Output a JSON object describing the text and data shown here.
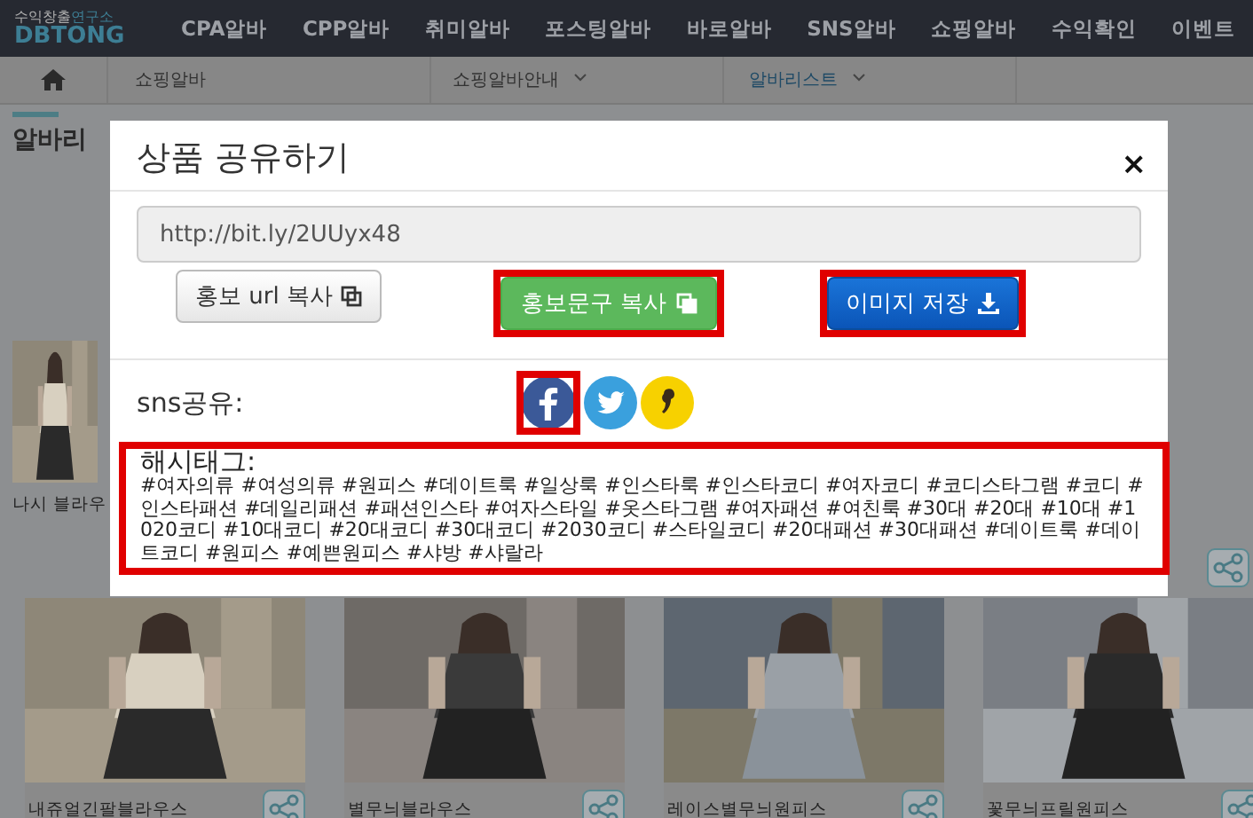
{
  "header": {
    "logo_top": "수익창출",
    "logo_top_accent": "연구소",
    "logo": "DBTONG",
    "nav": [
      {
        "label": "CPA알바",
        "selected": false
      },
      {
        "label": "CPP알바",
        "selected": false
      },
      {
        "label": "취미알바",
        "selected": false
      },
      {
        "label": "포스팅알바",
        "selected": false
      },
      {
        "label": "바로알바",
        "selected": false
      },
      {
        "label": "SNS알바",
        "selected": false
      },
      {
        "label": "쇼핑알바",
        "selected": false
      },
      {
        "label": "수익확인",
        "selected": false
      },
      {
        "label": "이벤트",
        "selected": false
      }
    ]
  },
  "subnav": [
    {
      "label": "쇼핑알바",
      "kind": "plain",
      "selected": false
    },
    {
      "label": "쇼핑알바안내",
      "kind": "dropdown",
      "selected": false
    },
    {
      "label": "알바리스트",
      "kind": "dropdown",
      "selected": true
    }
  ],
  "page_title": "알바리",
  "side_card": {
    "name": "나시 블라우"
  },
  "products": [
    {
      "name": "내쥬얼긴팔블라우스"
    },
    {
      "name": "별무늬블라우스"
    },
    {
      "name": "레이스별무늬원피스"
    },
    {
      "name": "꽃무늬프릴원피스"
    }
  ],
  "dialog": {
    "title": "상품 공유하기",
    "close": "×",
    "url": "http://bit.ly/2UUyx48",
    "buttons": [
      {
        "label": "홍보 url 복사",
        "kind": "default",
        "highlighted": false
      },
      {
        "label": "홍보문구 복사",
        "kind": "success",
        "highlighted": true
      },
      {
        "label": "이미지 저장",
        "kind": "primary",
        "highlighted": true
      }
    ],
    "sns_label": "sns공유:",
    "sns": [
      {
        "kind": "facebook",
        "highlighted": true
      },
      {
        "kind": "twitter",
        "highlighted": false
      },
      {
        "kind": "kakao",
        "highlighted": false
      }
    ],
    "hashtag_label": "해시태그:",
    "hashtags": "#여자의류 #여성의류 #원피스 #데이트룩 #일상룩 #인스타룩 #인스타코디 #여자코디 #코디스타그램 #코디 #인스타패션 #데일리패션 #패션인스타 #여자스타일 #옷스타그램 #여자패션 #여친룩 #30대 #20대 #10대 #1020코디 #10대코디 #20대코디 #30대코디 #2030코디 #스타일코디 #20대패션 #30대패션 #데이트룩 #데이트코디 #원피스 #예쁜원피스 #샤방 #샤랄라",
    "hashtags_highlighted": true
  }
}
